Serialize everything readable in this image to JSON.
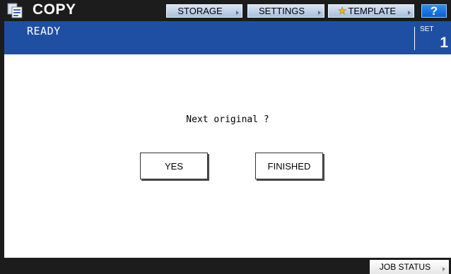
{
  "header": {
    "app_icon": "copy-icon",
    "title": "COPY",
    "buttons": {
      "storage": "STORAGE",
      "settings": "SETTINGS",
      "template": "TEMPLATE",
      "template_icon": "star-icon",
      "help": "?"
    }
  },
  "status": {
    "text": "READY",
    "set_label": "SET",
    "set_value": "1"
  },
  "dialog": {
    "prompt": "Next original ?",
    "yes": "YES",
    "finished": "FINISHED"
  },
  "footer": {
    "job_status": "JOB STATUS"
  },
  "colors": {
    "topbar": "#1c1c1c",
    "statusbar": "#1f4fa3",
    "help_button": "#0a5fd0",
    "template_star": "#f2b800"
  }
}
